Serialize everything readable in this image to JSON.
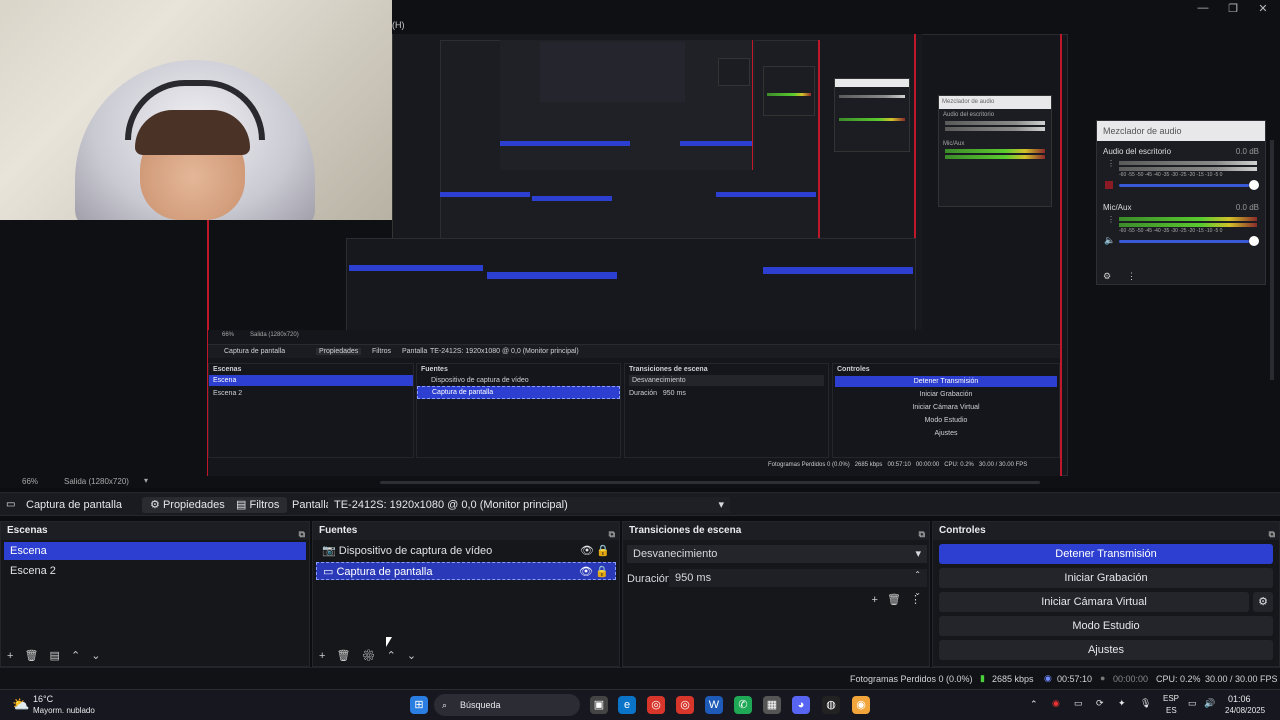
{
  "window": {
    "letter": "H",
    "controls": [
      "—",
      "❐",
      "✕"
    ]
  },
  "preview": {
    "mini_scene_labels": [
      "Escena",
      "Escena 2"
    ],
    "mini_sources": [
      "Dispositivo de captura de vídeo",
      "Captura de pantalla"
    ],
    "mini_transition": "Desvanecimiento",
    "mini_duration_label": "Duración",
    "mini_duration": "950 ms",
    "mini_controls": [
      "Detener Transmisión",
      "Iniciar Grabación",
      "Iniciar Cámara Virtual",
      "Modo Estudio",
      "Ajustes"
    ],
    "mini_panel_titles": [
      "Escenas",
      "Fuentes",
      "Transiciones de escena",
      "Controles"
    ],
    "mini_sourcebar": {
      "source": "Captura de pantalla",
      "props": "Propiedades",
      "filters": "Filtros",
      "display_label": "Pantalla",
      "display": "TE-2412S: 1920x1080 @ 0,0 (Monitor principal)"
    },
    "mini_zoom": "66%",
    "mini_output": "Salida (1280x720)",
    "mini_status": {
      "dropped": "Fotogramas Perdidos 0 (0.0%)",
      "kbps": "2685 kbps",
      "time": "00:57:10",
      "rec": "00:00:00",
      "cpu": "CPU: 0.2%",
      "fps": "30.00 / 30.00 FPS"
    },
    "mixer": {
      "title": "Mezclador de audio",
      "ch1": "Audio del escritorio",
      "ch1_db": "0.0 dB",
      "ch2": "Mic/Aux",
      "ch2_db": "0.0 dB",
      "scale": "-60 -55 -50 -45 -40 -35 -30 -25 -20 -15 -10 -5 0"
    }
  },
  "zoombar": {
    "zoom": "66%",
    "output": "Salida (1280x720)"
  },
  "sourcebar": {
    "source": "Captura de pantalla",
    "properties": "Propiedades",
    "filters": "Filtros",
    "display_label": "Pantalla",
    "display_value": "TE-2412S: 1920x1080 @ 0,0 (Monitor principal)"
  },
  "scenes": {
    "title": "Escenas",
    "items": [
      "Escena",
      "Escena 2"
    ]
  },
  "sources": {
    "title": "Fuentes",
    "items": [
      "Dispositivo de captura de vídeo",
      "Captura de pantalla"
    ]
  },
  "transitions": {
    "title": "Transiciones de escena",
    "selected": "Desvanecimiento",
    "duration_label": "Duración",
    "duration_value": "950 ms"
  },
  "controls": {
    "title": "Controles",
    "buttons": [
      "Detener Transmisión",
      "Iniciar Grabación",
      "Iniciar Cámara Virtual",
      "Modo Estudio",
      "Ajustes"
    ]
  },
  "status": {
    "dropped": "Fotogramas Perdidos 0 (0.0%)",
    "kbps": "2685 kbps",
    "stream_time": "00:57:10",
    "rec_time": "00:00:00",
    "cpu": "CPU: 0.2%",
    "fps": "30.00 / 30.00 FPS"
  },
  "taskbar": {
    "weather_temp": "16°C",
    "weather_desc": "Mayorm. nublado",
    "search": "Búsqueda",
    "lang1": "ESP",
    "lang2": "ES",
    "time": "01:06",
    "date": "24/08/2025"
  },
  "colors": {
    "accent": "#2d3fd0",
    "record_red": "#c0182b",
    "bg": "#16171b"
  }
}
